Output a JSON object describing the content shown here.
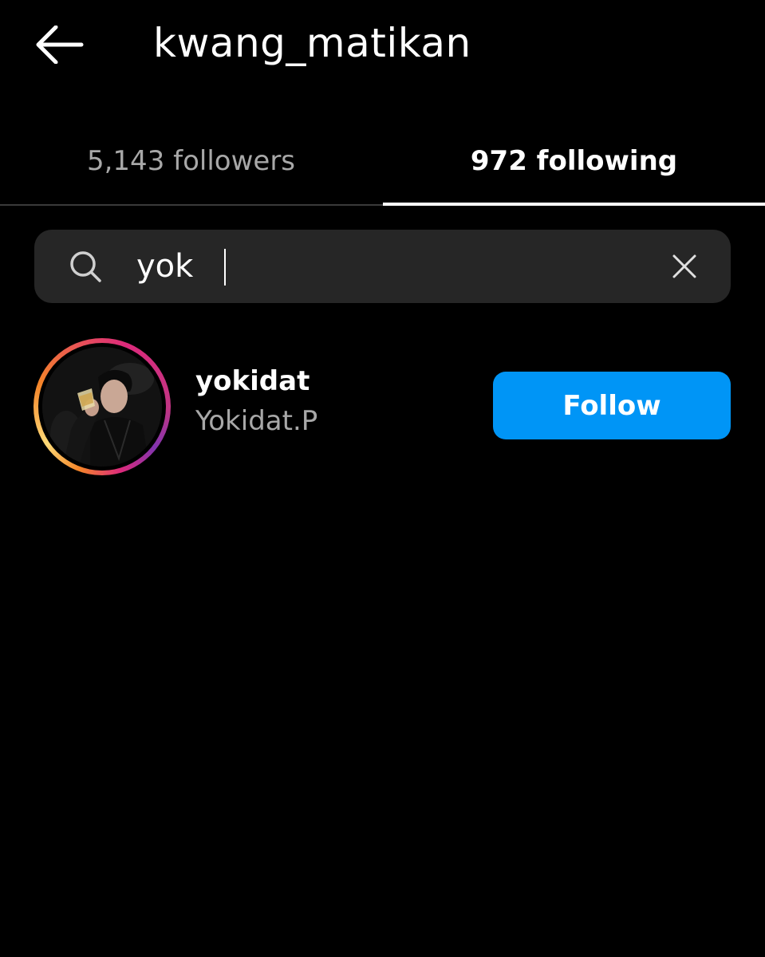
{
  "header": {
    "back_icon": "arrow-left-icon",
    "title": "kwang_matikan"
  },
  "tabs": [
    {
      "label": "5,143 followers",
      "active": false
    },
    {
      "label": "972 following",
      "active": true
    }
  ],
  "search": {
    "icon": "search-icon",
    "value": "yok",
    "clear_icon": "close-icon"
  },
  "results": [
    {
      "username": "yokidat",
      "full_name": "Yokidat.P",
      "button_label": "Follow",
      "has_story_ring": true
    }
  ],
  "colors": {
    "background": "#000000",
    "search_bg": "#262626",
    "follow_button": "#0095f6",
    "muted_text": "#a8a8a8",
    "active_tab_indicator": "#ffffff"
  }
}
